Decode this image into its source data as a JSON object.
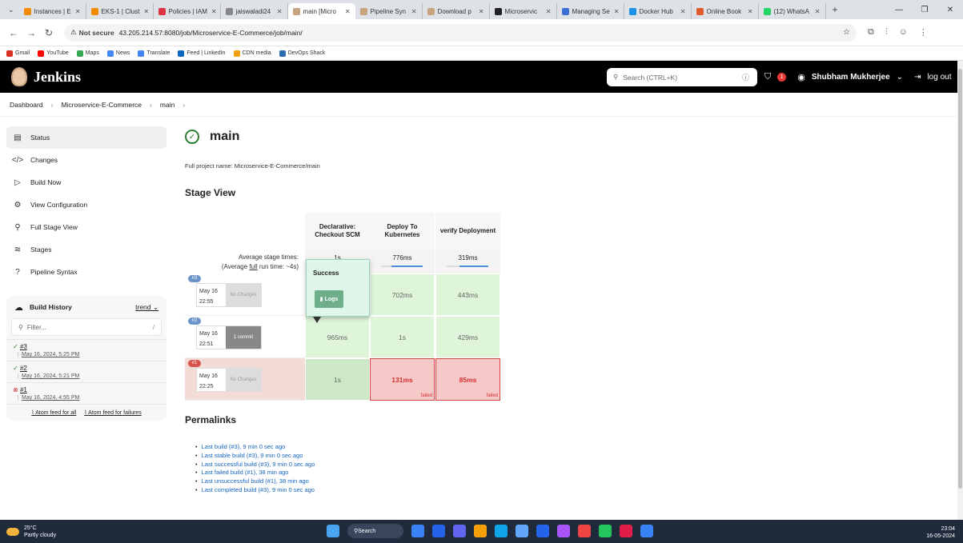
{
  "browser": {
    "tabs": [
      {
        "label": "Instances | E",
        "color": "#f28b00"
      },
      {
        "label": "EKS-1 | Clust",
        "color": "#f28b00"
      },
      {
        "label": "Policies | IAM",
        "color": "#dd3344"
      },
      {
        "label": "jaiswaladi24",
        "color": "#888888"
      },
      {
        "label": "main [Micro",
        "color": "#c7a37f",
        "active": true
      },
      {
        "label": "Pipeline Syn",
        "color": "#c7a37f"
      },
      {
        "label": "Download p",
        "color": "#c7a37f"
      },
      {
        "label": "Microservic",
        "color": "#222222"
      },
      {
        "label": "Managing Se",
        "color": "#3b6fd6"
      },
      {
        "label": "Docker Hub",
        "color": "#1d91e6"
      },
      {
        "label": "Online Book",
        "color": "#e05a2b"
      },
      {
        "label": "(12) WhatsA",
        "color": "#25d366"
      }
    ],
    "not_secure": "Not secure",
    "url": "43.205.214.57:8080/job/Microservice-E-Commerce/job/main/",
    "bookmarks": [
      {
        "label": "Gmail",
        "color": "#d93025"
      },
      {
        "label": "YouTube",
        "color": "#ff0000"
      },
      {
        "label": "Maps",
        "color": "#34a853"
      },
      {
        "label": "News",
        "color": "#4285f4"
      },
      {
        "label": "Translate",
        "color": "#4285f4"
      },
      {
        "label": "Feed | LinkedIn",
        "color": "#0a66c2"
      },
      {
        "label": "CDN media",
        "color": "#f59e0b"
      },
      {
        "label": "DevOps Shack",
        "color": "#2b6cb0"
      }
    ]
  },
  "header": {
    "brand": "Jenkins",
    "search_placeholder": "Search (CTRL+K)",
    "notification_count": "1",
    "user": "Shubham Mukherjee",
    "logout": "log out"
  },
  "breadcrumb": [
    "Dashboard",
    "Microservice-E-Commerce",
    "main"
  ],
  "sidebar": {
    "items": [
      {
        "label": "Status",
        "icon": "▤"
      },
      {
        "label": "Changes",
        "icon": "</>"
      },
      {
        "label": "Build Now",
        "icon": "▷"
      },
      {
        "label": "View Configuration",
        "icon": "⚙"
      },
      {
        "label": "Full Stage View",
        "icon": "⚲"
      },
      {
        "label": "Stages",
        "icon": "≋"
      },
      {
        "label": "Pipeline Syntax",
        "icon": "?"
      }
    ],
    "build_history": {
      "title": "Build History",
      "trend": "trend",
      "filter_placeholder": "Filter...",
      "filter_key": "/",
      "builds": [
        {
          "num": "#3",
          "date": "May 16, 2024, 5:25 PM",
          "status": "ok"
        },
        {
          "num": "#2",
          "date": "May 16, 2024, 5:21 PM",
          "status": "ok"
        },
        {
          "num": "#1",
          "date": "May 16, 2024, 4:55 PM",
          "status": "fail"
        }
      ],
      "atom_all": "Atom feed for all",
      "atom_fail": "Atom feed for failures"
    }
  },
  "main": {
    "title": "main",
    "full_name": "Full project name: Microservice-E-Commerce/main",
    "stage_view_title": "Stage View",
    "avg_label_1": "Average stage times:",
    "avg_label_2a": "(Average ",
    "avg_label_2b": "full",
    "avg_label_2c": " run time: ~4s)",
    "stages": [
      {
        "name": "Declarative: Checkout SCM",
        "avg": "1s",
        "progress": 0.5
      },
      {
        "name": "Deploy To Kubernetes",
        "avg": "776ms",
        "progress": 0.75
      },
      {
        "name": "verify Deployment",
        "avg": "319ms",
        "progress": 0.7
      }
    ],
    "runs": [
      {
        "badge": "#3",
        "date": "May 16",
        "time": "22:55",
        "changes": "No Changes",
        "commit": false,
        "cells": [
          {
            "v": "",
            "s": "ok"
          },
          {
            "v": "702ms",
            "s": "ok"
          },
          {
            "v": "443ms",
            "s": "ok"
          }
        ],
        "badge_color": "#6b95c8",
        "row_bg": "#ffffff"
      },
      {
        "badge": "#2",
        "date": "May 16",
        "time": "22:51",
        "changes": "1 commit",
        "commit": true,
        "cells": [
          {
            "v": "965ms",
            "s": "ok"
          },
          {
            "v": "1s",
            "s": "ok"
          },
          {
            "v": "429ms",
            "s": "ok"
          }
        ],
        "badge_color": "#6b95c8",
        "row_bg": "#ffffff"
      },
      {
        "badge": "#1",
        "date": "May 16",
        "time": "22:25",
        "changes": "No Changes",
        "commit": false,
        "cells": [
          {
            "v": "1s",
            "s": "ok2"
          },
          {
            "v": "131ms",
            "s": "fail",
            "label": "failed"
          },
          {
            "v": "85ms",
            "s": "fail",
            "label": "failed"
          }
        ],
        "badge_color": "#d9534f",
        "row_bg": "#f4dcd6"
      }
    ],
    "popup": {
      "title": "Success",
      "logs": "Logs"
    },
    "permalinks_title": "Permalinks",
    "permalinks": [
      "Last build (#3), 9 min 0 sec ago",
      "Last stable build (#3), 9 min 0 sec ago",
      "Last successful build (#3), 9 min 0 sec ago",
      "Last failed build (#1), 38 min ago",
      "Last unsuccessful build (#1), 38 min ago",
      "Last completed build (#3), 9 min 0 sec ago"
    ]
  },
  "taskbar": {
    "temp": "25°C",
    "weather": "Partly cloudy",
    "search": "Search",
    "time": "23:04",
    "date": "16-05-2024",
    "icons": [
      "#3b82f6",
      "#2563eb",
      "#6366f1",
      "#f59e0b",
      "#0ea5e9",
      "#60a5fa",
      "#2563eb",
      "#a855f7",
      "#ef4444",
      "#22c55e",
      "#e11d48",
      "#3b82f6"
    ]
  }
}
